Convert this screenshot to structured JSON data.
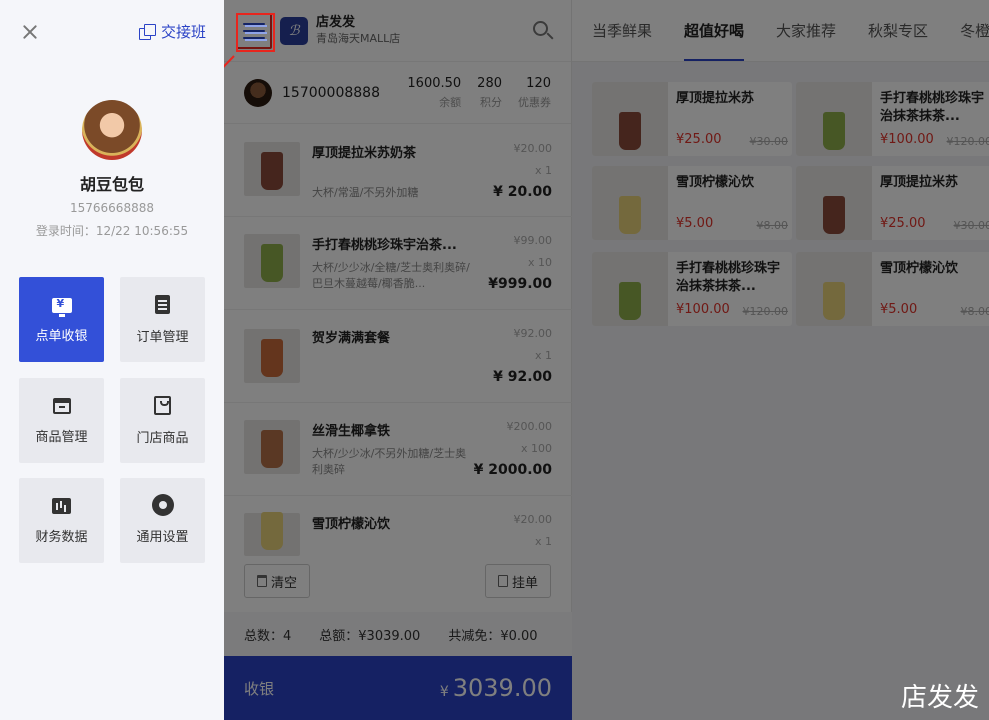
{
  "store": {
    "name": "店发发",
    "branch": "青岛海天MALL店"
  },
  "member": {
    "phone": "15700008888",
    "stats": [
      {
        "value": "1600.50",
        "label": "余额"
      },
      {
        "value": "280",
        "label": "积分"
      },
      {
        "value": "120",
        "label": "优惠券"
      }
    ]
  },
  "cart": {
    "items": [
      {
        "name": "厚顶提拉米苏奶茶",
        "spec": "大杯/常温/不另外加糖",
        "orig": "¥20.00",
        "qty": "x 1",
        "price": "¥ 20.00",
        "cup": "#8a4a3a"
      },
      {
        "name": "手打春桃桃珍珠宇治茶...",
        "spec": "大杯/少少冰/全糖/芝士奥利奥碎/巴旦木蔓越莓/椰香脆...",
        "orig": "¥99.00",
        "qty": "x 10",
        "price": "¥999.00",
        "cup": "#8fae4a"
      },
      {
        "name": "贺岁满满套餐",
        "spec": "",
        "orig": "¥92.00",
        "qty": "x 1",
        "price": "¥ 92.00",
        "cup": "#c96a3a"
      },
      {
        "name": "丝滑生椰拿铁",
        "spec": "大杯/少少冰/不另外加糖/芝士奥利奥碎",
        "orig": "¥200.00",
        "qty": "x 100",
        "price": "¥ 2000.00",
        "cup": "#b57048"
      },
      {
        "name": "雪顶柠檬沁饮",
        "spec": "",
        "orig": "¥20.00",
        "qty": "x 1",
        "price": "",
        "cup": "#e8d27a"
      }
    ],
    "clear_label": "清空",
    "hold_label": "挂单",
    "summary": {
      "count": "总数：4",
      "total": "总额：¥3039.00",
      "discount": "共减免：¥0.00"
    },
    "checkout_label": "收银",
    "checkout_currency": "¥",
    "checkout_total": "3039.00"
  },
  "catalog": {
    "tabs": [
      "当季鲜果",
      "超值好喝",
      "大家推荐",
      "秋梨专区",
      "冬橙"
    ],
    "active_tab": 1,
    "products": [
      {
        "name": "厚顶提拉米苏",
        "price": "¥25.00",
        "orig": "¥30.00",
        "cup": "#8a4a3a"
      },
      {
        "name": "手打春桃桃珍珠宇治抹茶抹茶...",
        "price": "¥100.00",
        "orig": "¥120.00",
        "cup": "#8fae4a"
      },
      {
        "name": "雪顶柠檬沁饮",
        "price": "¥5.00",
        "orig": "¥8.00",
        "cup": "#e8d27a"
      },
      {
        "name": "厚顶提拉米苏",
        "price": "¥25.00",
        "orig": "¥30.00",
        "cup": "#8a4a3a"
      },
      {
        "name": "手打春桃桃珍珠宇治抹茶抹茶...",
        "price": "¥100.00",
        "orig": "¥120.00",
        "cup": "#8fae4a"
      },
      {
        "name": "雪顶柠檬沁饮",
        "price": "¥5.00",
        "orig": "¥8.00",
        "cup": "#e8d27a"
      }
    ]
  },
  "drawer": {
    "handover_label": "交接班",
    "user_name": "胡豆包包",
    "user_phone": "15766668888",
    "login_time": "登录时间：12/22 10:56:55",
    "tiles": [
      {
        "label": "点单收银",
        "icon": "cash-register-icon"
      },
      {
        "label": "订单管理",
        "icon": "order-doc-icon"
      },
      {
        "label": "商品管理",
        "icon": "product-box-icon"
      },
      {
        "label": "门店商品",
        "icon": "store-clipboard-icon"
      },
      {
        "label": "财务数据",
        "icon": "finance-chart-icon"
      },
      {
        "label": "通用设置",
        "icon": "gear-icon"
      }
    ]
  },
  "watermark": "店发发",
  "colors": {
    "accent": "#2b43c6",
    "active_tile": "#3350d8",
    "price_red": "#e0322a",
    "highlight_red": "#e8261e"
  }
}
